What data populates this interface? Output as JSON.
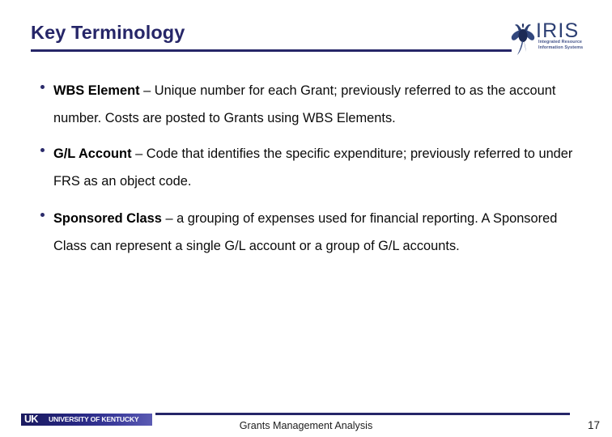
{
  "slide": {
    "title": "Key Terminology",
    "page_number": "17",
    "accent_color": "#262668",
    "text_color": "#000000"
  },
  "brand": {
    "iris_wordmark": "IRIS",
    "iris_tagline_line1": "Integrated Resource",
    "iris_tagline_line2": "Information Systems",
    "iris_icon": "iris-flower-icon"
  },
  "bullets": [
    {
      "term": "WBS Element",
      "definition": " – Unique number for each Grant; previously referred to as the account number.  Costs are posted to Grants using WBS Elements."
    },
    {
      "term": "G/L Account",
      "definition": " – Code that identifies the specific expenditure; previously referred to under FRS as an object code."
    },
    {
      "term": "Sponsored Class",
      "definition": " – a grouping of expenses used for financial reporting.   A Sponsored Class can represent a single G/L account or a group of G/L accounts."
    }
  ],
  "footer": {
    "uk_mark": "UK",
    "uk_name": "UNIVERSITY OF KENTUCKY",
    "center_text": "Grants Management Analysis"
  }
}
